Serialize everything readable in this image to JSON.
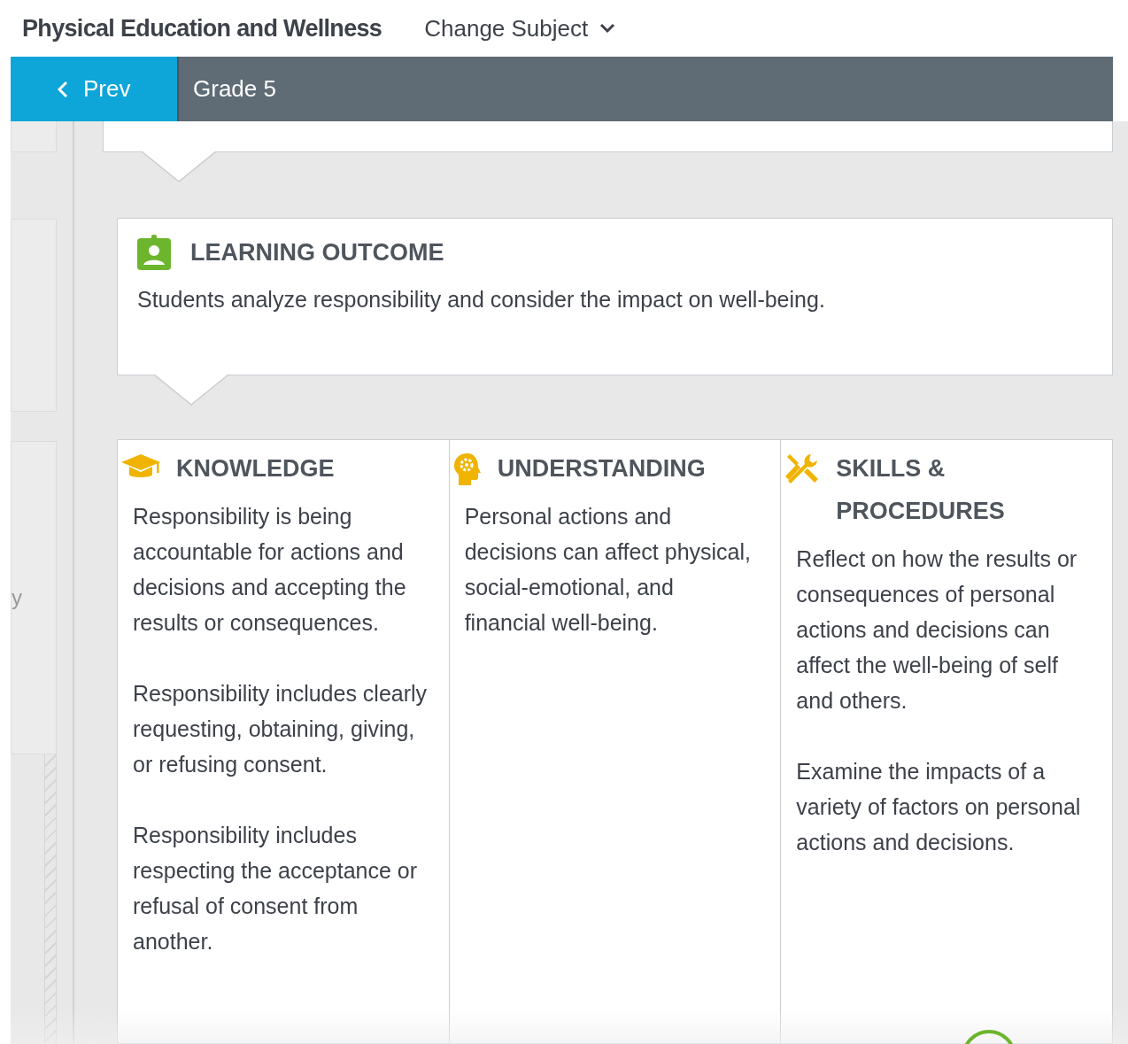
{
  "header": {
    "title": "Physical Education and Wellness",
    "change_subject": "Change Subject"
  },
  "nav": {
    "prev": "Prev",
    "grade": "Grade 5"
  },
  "sidebar": {
    "partial_text": "y"
  },
  "learning_outcome": {
    "heading": "LEARNING OUTCOME",
    "text": "Students analyze responsibility and consider the impact on well-being."
  },
  "columns": [
    {
      "kind": "knowledge",
      "heading": "KNOWLEDGE",
      "paragraphs": [
        "Responsibility is being accountable for actions and decisions and accepting the results or consequences.",
        "Responsibility includes clearly requesting, obtaining, giving, or refusing consent.",
        "Responsibility includes respecting the acceptance or refusal of consent from another."
      ]
    },
    {
      "kind": "understanding",
      "heading": "UNDERSTANDING",
      "paragraphs": [
        "Personal actions and decisions can affect physical, social-emotional, and financial well-being."
      ]
    },
    {
      "kind": "skills",
      "heading": "SKILLS & PROCEDURES",
      "paragraphs": [
        "Reflect on how the results or consequences of personal actions and decisions can affect the well-being of self and others.",
        "Examine the impacts of a variety of factors on personal actions and decisions."
      ]
    }
  ]
}
